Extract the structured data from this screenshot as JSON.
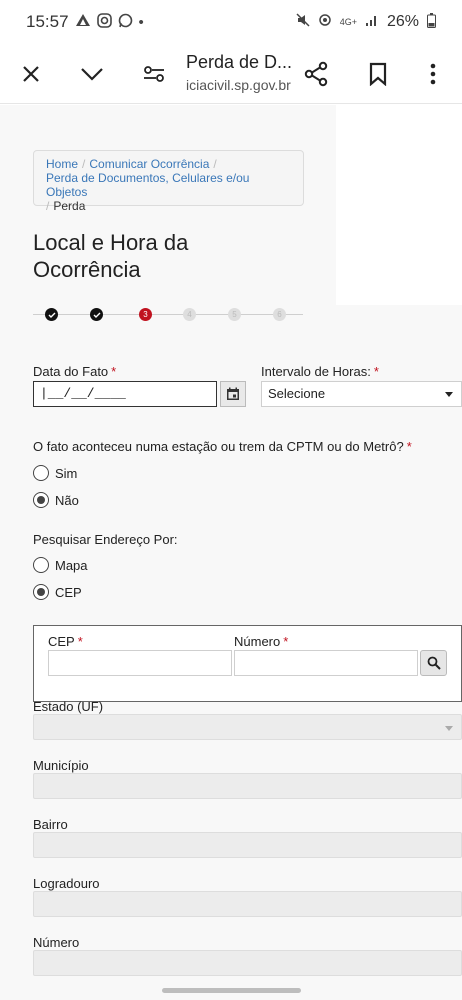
{
  "status_bar": {
    "time": "15:57",
    "battery": "26%",
    "network": "4G+"
  },
  "toolbar": {
    "page_title": "Perda de D...",
    "url": "iciacivil.sp.gov.br"
  },
  "breadcrumb": {
    "items": [
      "Home",
      "Comunicar Ocorrência",
      "Perda de Documentos, Celulares e/ou Objetos",
      "Perda"
    ]
  },
  "page": {
    "title": "Local e Hora da Ocorrência"
  },
  "stepper": {
    "current_step": "3",
    "total_steps": 6,
    "completed_steps": 2
  },
  "form": {
    "date_label": "Data do Fato",
    "date_value": "|__/__/____",
    "hours_label": "Intervalo de Horas:",
    "hours_value": "Selecione",
    "station_question": "O fato aconteceu numa estação ou trem da CPTM ou do Metrô?",
    "station_options": [
      "Sim",
      "Não"
    ],
    "station_selected": "Não",
    "search_by_label": "Pesquisar Endereço Por:",
    "search_by_options": [
      "Mapa",
      "CEP"
    ],
    "search_by_selected": "CEP",
    "cep_label": "CEP",
    "numero_label": "Número",
    "estado_label": "Estado (UF)",
    "municipio_label": "Município",
    "bairro_label": "Bairro",
    "logradouro_label": "Logradouro",
    "numero2_label": "Número",
    "required_mark": "*"
  },
  "colors": {
    "required": "#c0121f",
    "link": "#3a77b8",
    "step_current": "#c0121f",
    "step_done": "#111111"
  }
}
